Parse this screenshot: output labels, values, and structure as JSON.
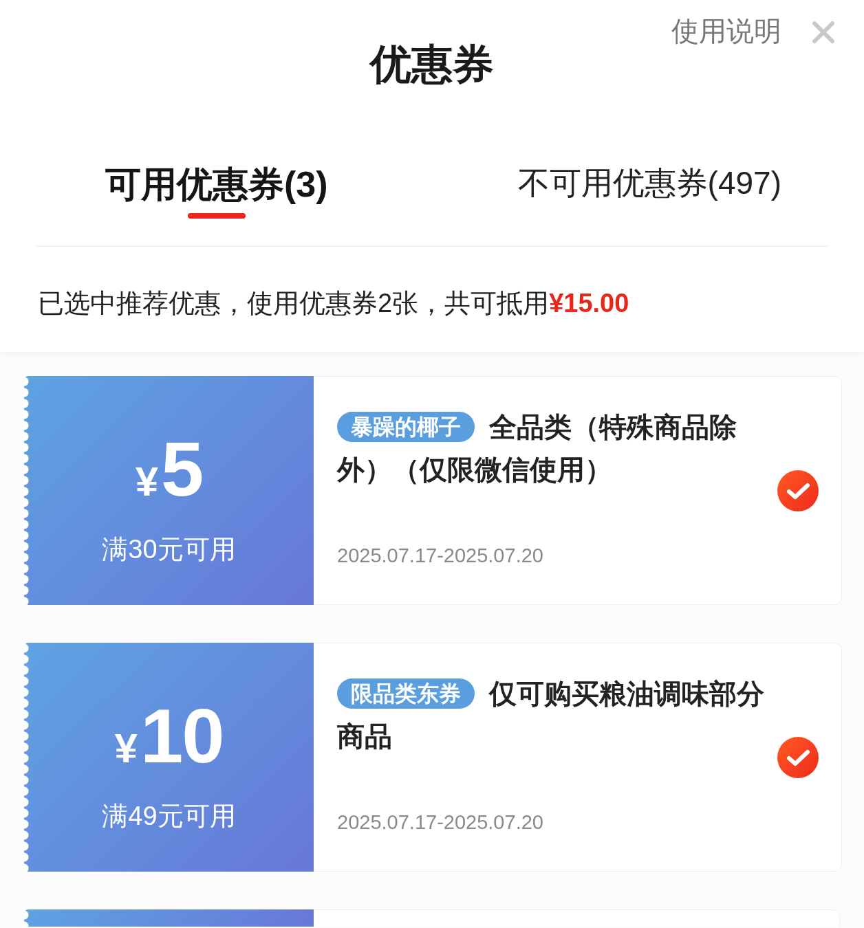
{
  "header": {
    "title": "优惠券",
    "help_link": "使用说明"
  },
  "tabs": [
    {
      "label": "可用优惠券(3)",
      "selected": true
    },
    {
      "label": "不可用优惠券(497)",
      "selected": false
    }
  ],
  "summary": {
    "text": "已选中推荐优惠，使用优惠券2张，共可抵用",
    "amount": "¥15.00"
  },
  "coupons": [
    {
      "kind": "full",
      "currency": "¥",
      "amount": "5",
      "condition": "满30元可用",
      "tag": "暴躁的椰子",
      "title_lines": [
        "全品类（特殊商品除",
        "外）（仅限微信使用）"
      ],
      "validity": "2025.07.17-2025.07.20",
      "selected": true
    },
    {
      "kind": "full",
      "currency": "¥",
      "amount": "10",
      "condition": "满49元可用",
      "tag": "限品类东券",
      "title_lines": [
        "仅可购买粮油调味部分",
        "商品"
      ],
      "validity": "2025.07.17-2025.07.20",
      "selected": true
    },
    {
      "kind": "cut-off"
    }
  ]
}
